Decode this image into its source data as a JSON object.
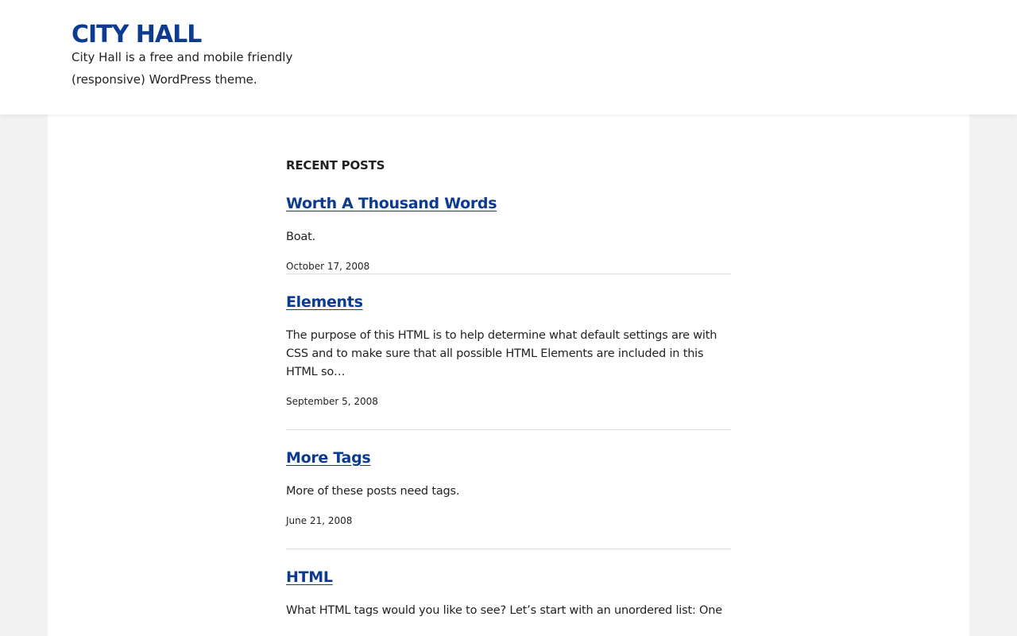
{
  "site": {
    "title": "CITY HALL",
    "description": "City Hall is a free and mobile friendly (responsive) WordPress theme."
  },
  "recent_posts": {
    "heading": "RECENT POSTS",
    "posts": [
      {
        "title": "Worth A Thousand Words",
        "excerpt": "Boat.",
        "date": "October 17, 2008"
      },
      {
        "title": "Elements",
        "excerpt": "The purpose of this HTML is to help determine what default settings are with CSS and to make sure that all possible HTML Elements are included in this HTML so…",
        "date": "September 5, 2008"
      },
      {
        "title": "More Tags",
        "excerpt": "More of these posts need tags.",
        "date": "June 21, 2008"
      },
      {
        "title": "HTML",
        "excerpt": "What HTML tags would you like to see? Let’s start with an unordered list: One"
      }
    ]
  },
  "colors": {
    "accent": "#0d3b8f",
    "text": "#222222",
    "page_background": "#f2f2f2",
    "panel_background": "#ffffff"
  }
}
